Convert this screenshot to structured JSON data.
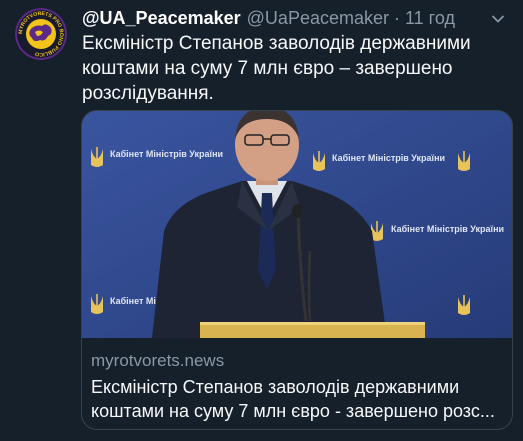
{
  "tweet": {
    "display_name": "@UA_Peacemaker",
    "handle": "@UaPeacemaker",
    "separator": "·",
    "time": "11 год",
    "text": "Ексміністр Степанов заволодів державними коштами на суму 7 млн євро – завершено розслідування.",
    "avatar": {
      "logo_text": "MYROTVORETS PRO BONO PUBLICO"
    }
  },
  "card": {
    "domain": "myrotvorets.news",
    "title": "Ексміністр Степанов заволодів державними коштами на суму 7 млн євро - завершено розс...",
    "backdrop_text": "Кабінет Міністрів України"
  },
  "colors": {
    "background": "#15202b",
    "secondary_text": "#8b98a5",
    "card_border": "#38444d",
    "backdrop_blue": "#2f4585",
    "avatar_gold": "#f0c419",
    "avatar_purple": "#5b2a86"
  },
  "icons": {
    "more": "chevron-down-icon",
    "avatar": "globe-icon",
    "backdrop_emblem": "trident-icon"
  }
}
